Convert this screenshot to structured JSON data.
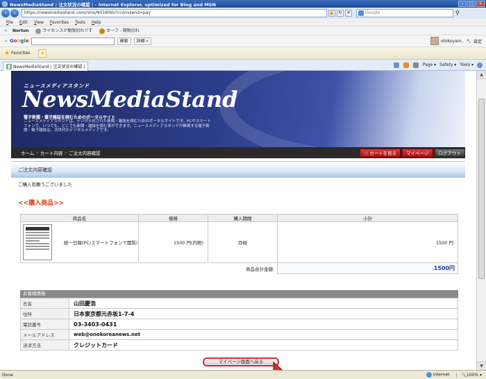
{
  "window": {
    "title": "NewsMediaStand | 注文状況の確認 | - Internet Explorer, optimized for Bing and MSN"
  },
  "address": {
    "url": "https://newsmediastand.com/nms/N0180ds?cconvsend=pay",
    "search_placeholder": "Google"
  },
  "menu": [
    "File",
    "Edit",
    "View",
    "Favorites",
    "Tools",
    "Help"
  ],
  "norton": {
    "label": "Norton",
    "license": "ライセンスが期限切れです",
    "safe": "セーフ - 期限切れ"
  },
  "google": {
    "search_btn": "検索",
    "detail_btn": "詳細 »",
    "user": "otokoyam..",
    "settings": "設定"
  },
  "favorites": {
    "label": "Favorites"
  },
  "tabs": {
    "active": "NewsMediaStand | 注文状況の確認 |",
    "commands": [
      "Page",
      "Safety",
      "Tools"
    ]
  },
  "site": {
    "logo_sub": "ニュースメディアスタンド",
    "logo": "NewsMediaStand",
    "tagline": "電子新聞・電子雑誌を読むためのポータルサイト",
    "desc": "ニュースメディアスタンドは、デジタル化された新聞・雑誌を読むためのポータルサイトです。PCやスマートフォンで、いつでも、どこでも新聞・雑誌を読む事ができます。ニュースメディアスタンドが推奨する電子新聞・電子雑誌は、次世代のデジタルメディアです。"
  },
  "breadcrumb": {
    "home": "ホーム",
    "cart": "カート内容",
    "current": "ご注文内容確認",
    "sep": "›"
  },
  "header_buttons": {
    "cart": "カートを見る",
    "mypage": "マイページ",
    "logout": "ログアウト"
  },
  "section_title": "ご注文内容確認",
  "thanks": "ご購入有難うございました",
  "products_title": "<<購入商品>>",
  "products": {
    "columns": [
      "商品名",
      "価格",
      "購入期間",
      "小計"
    ],
    "rows": [
      {
        "name": "統一日報(PC/スマートフォンで閲覧)",
        "price": "1500 円(内税)",
        "period": "月極",
        "subtotal": "1500 円"
      }
    ],
    "total_label": "商品合計金額",
    "total_value": "1500円"
  },
  "customer": {
    "title": "お客様情報",
    "rows": [
      {
        "label": "氏名",
        "value": "山田慶浩"
      },
      {
        "label": "住所",
        "value": "日本東京都元赤坂1-7-4"
      },
      {
        "label": "電話番号",
        "value": "03-3403-0431"
      },
      {
        "label": "メールアドレス",
        "value": "web@onekoreanews.net"
      },
      {
        "label": "決済方法",
        "value": "クレジットカード"
      }
    ]
  },
  "back_button": "マイページ画面へ戻る",
  "status": {
    "left": "Done",
    "zone": "Internet",
    "zoom": "100%"
  },
  "colors": {
    "accent_red": "#d43030",
    "header_blue": "#2d3d8a",
    "total_blue": "#1a3e9a",
    "products_title": "#e04010"
  }
}
